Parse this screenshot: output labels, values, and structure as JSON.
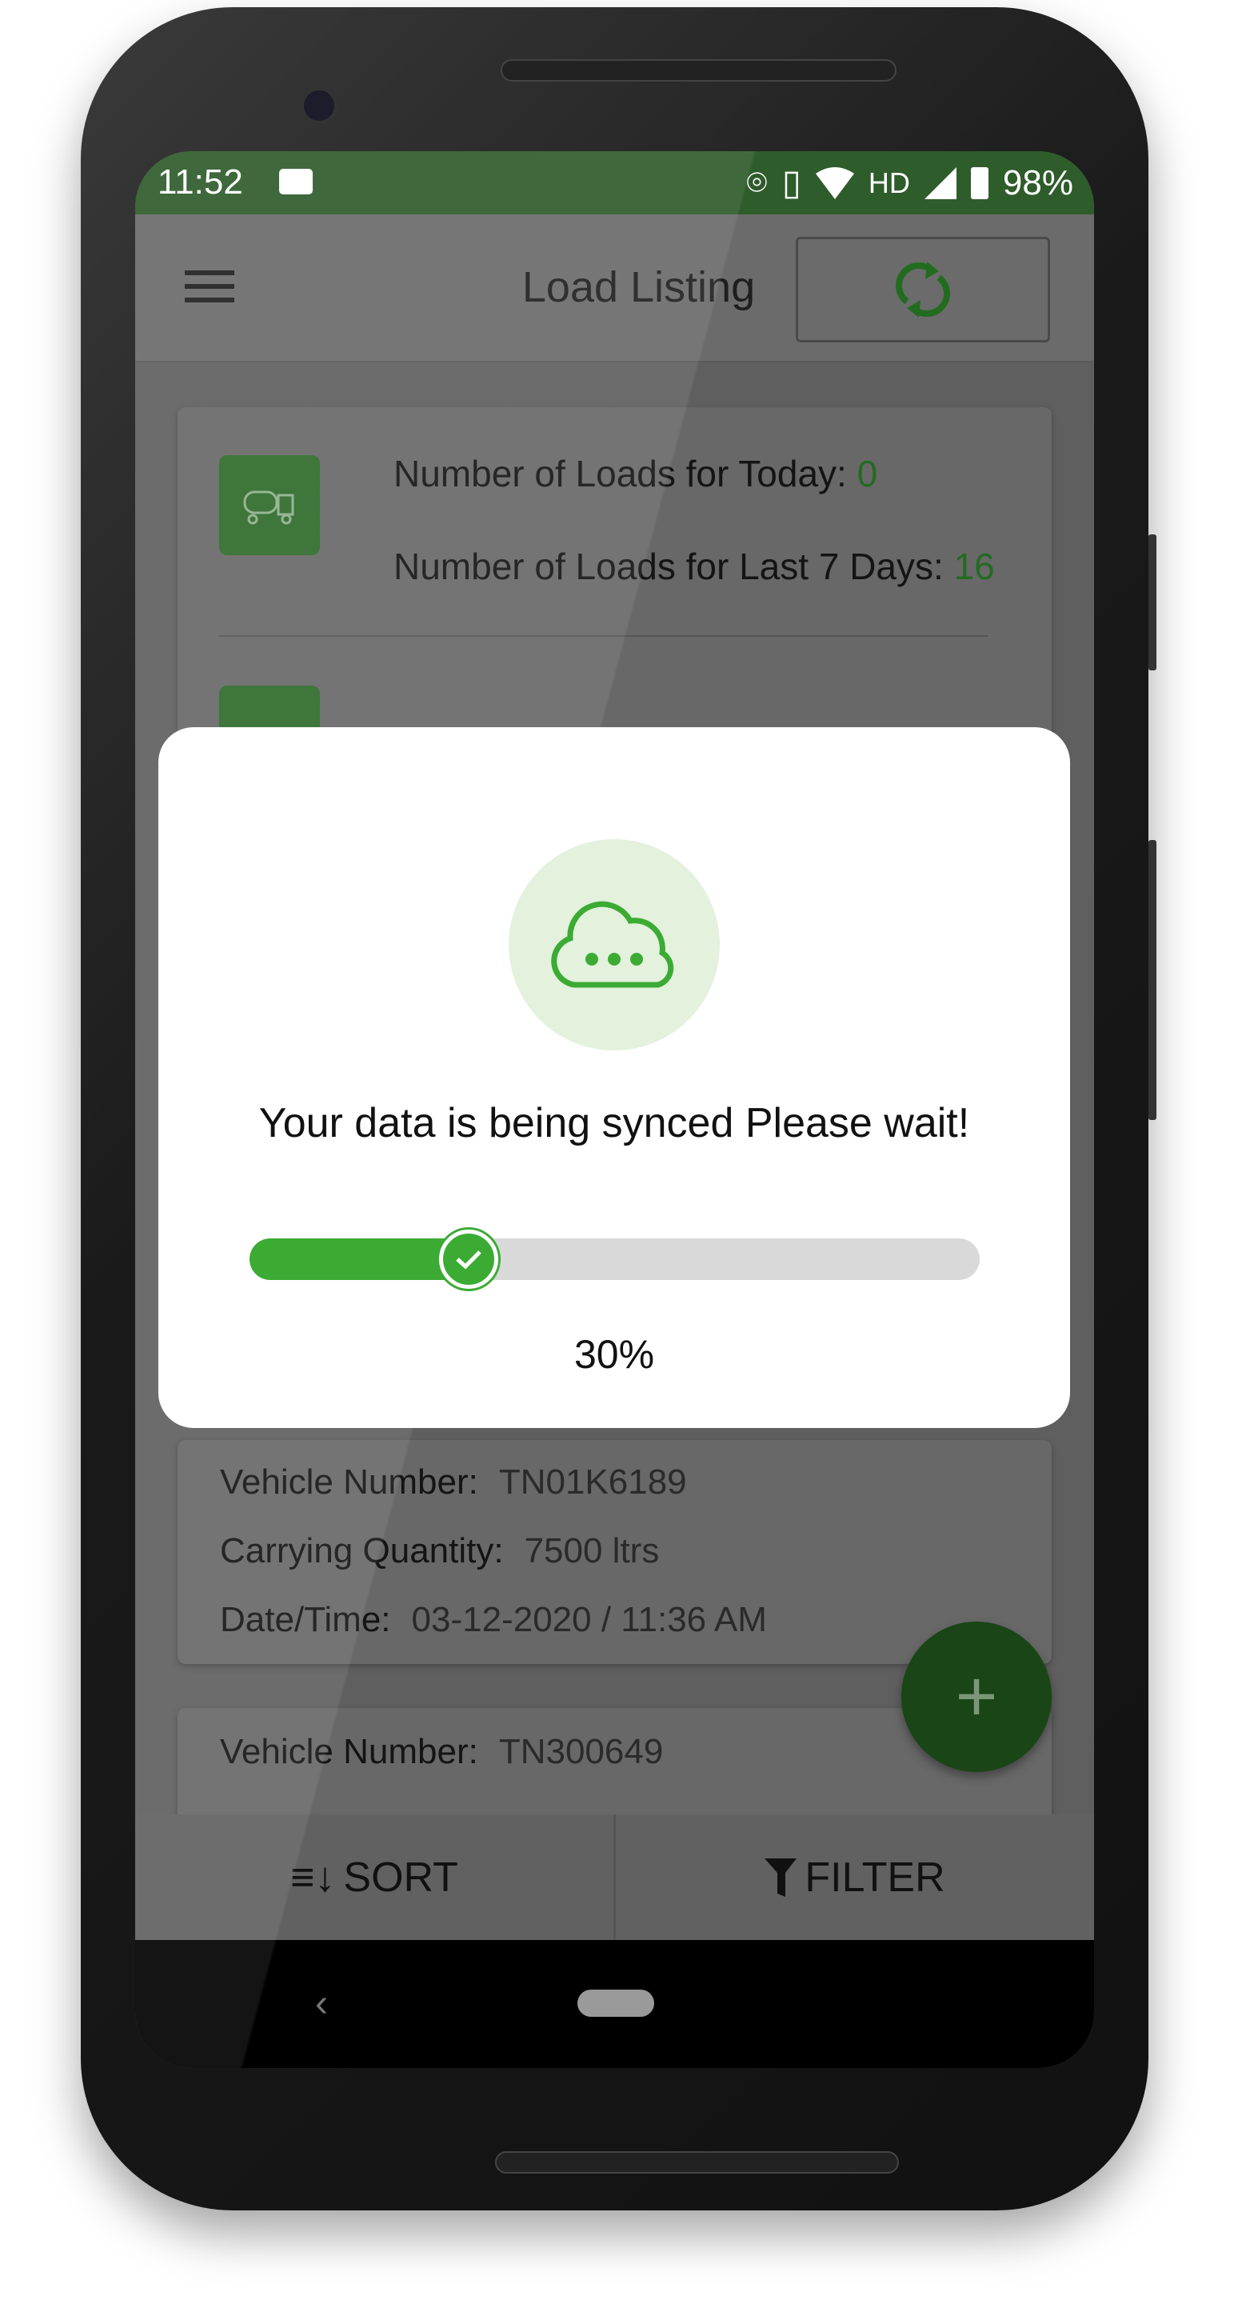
{
  "status_bar": {
    "time": "11:52",
    "battery": "98%",
    "network": "HD",
    "icons": [
      "news-icon",
      "location-icon",
      "vibrate-icon",
      "wifi-icon",
      "signal-icon",
      "battery-icon"
    ]
  },
  "app_bar": {
    "title": "Load Listing",
    "menu_icon": "hamburger-icon",
    "sync_icon": "sync-icon"
  },
  "summary": {
    "today_label": "Number of Loads for Today:",
    "today_value": "0",
    "week_label": "Number of Loads for Last 7 Days:",
    "week_value": "16"
  },
  "loads": [
    {
      "vehicle_label": "Vehicle Number:",
      "vehicle": "TN01K6189",
      "qty_label": "Carrying Quantity:",
      "qty": "7500 ltrs",
      "dt_label": "Date/Time:",
      "dt": "03-12-2020 / 11:36 AM"
    },
    {
      "vehicle_label": "Vehicle Number:",
      "vehicle": "TN300649"
    }
  ],
  "bottom_bar": {
    "sort": "SORT",
    "filter": "FILTER"
  },
  "fab": {
    "label": "+"
  },
  "dialog": {
    "message": "Your data is being synced Please wait!",
    "progress": 30,
    "progress_label": "30%"
  },
  "colors": {
    "accent": "#3bab34",
    "status_bar": "#2f5c2b",
    "fab": "#1a4516"
  }
}
